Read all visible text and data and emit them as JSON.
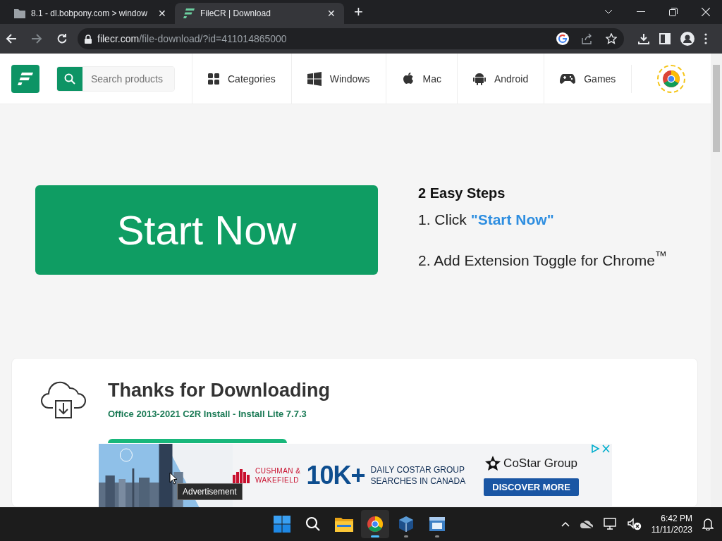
{
  "browser": {
    "tabs": [
      {
        "title": "8.1 - dl.bobpony.com > window",
        "kind": "folder",
        "close": "✕",
        "selected": false
      },
      {
        "title": "FileCR | Download",
        "kind": "site",
        "close": "✕",
        "selected": true
      }
    ],
    "new_tab": "+",
    "address": {
      "host": "filecr.com",
      "path": "/file-download/?id=411014865000"
    }
  },
  "header": {
    "search": {
      "placeholder": "Search products"
    },
    "nav": [
      {
        "label": "Categories",
        "kind": "grid"
      },
      {
        "label": "Windows",
        "kind": "windows"
      },
      {
        "label": "Mac",
        "kind": "apple"
      },
      {
        "label": "Android",
        "kind": "android"
      },
      {
        "label": "Games",
        "kind": "gamepad"
      }
    ]
  },
  "hero": {
    "button": "Start Now",
    "steps_title": "2 Easy Steps",
    "steps": [
      {
        "text": "1. Click ",
        "highlight": "\"Start Now\""
      },
      {
        "text": "2. Add Extension Toggle for Chrome$^{™}$"
      }
    ]
  },
  "card": {
    "title": "Thanks for Downloading",
    "subtitle": "Office 2013-2021 C2R Install - Install Lite 7.7.3"
  },
  "ad": {
    "sponsor_line_1": "CUSHMAN &",
    "sponsor_line_2": "WAKEFIELD",
    "headline": "10K+",
    "tagline_1": "DAILY COSTAR GROUP",
    "tagline_2": "SEARCHES IN CANADA",
    "brand": "CoStar Group",
    "cta": "DISCOVER MORE",
    "tooltip": "Advertisement"
  },
  "taskbar": {
    "apps": [
      {
        "kind": "start",
        "selected": false,
        "running": false
      },
      {
        "kind": "search",
        "selected": false,
        "running": false
      },
      {
        "kind": "explorer",
        "selected": false,
        "running": false
      },
      {
        "kind": "chrome",
        "selected": true,
        "running": true
      },
      {
        "kind": "virtualbox",
        "selected": false,
        "running": true
      },
      {
        "kind": "app",
        "selected": false,
        "running": true
      }
    ],
    "time": "6:42 PM",
    "date": "11/11/2023"
  }
}
